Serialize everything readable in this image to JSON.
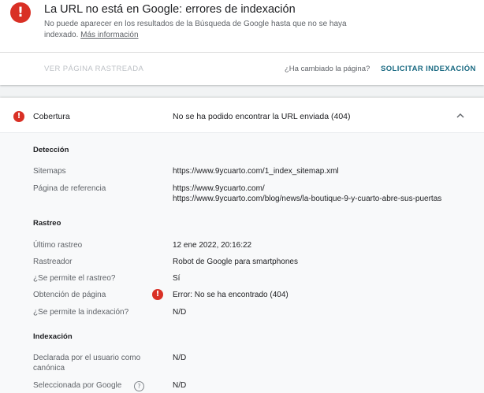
{
  "status_card": {
    "title": "La URL no está en Google: errores de indexación",
    "description": "No puede aparecer en los resultados de la Búsqueda de Google hasta que no se haya indexado.",
    "more_info_link": "Más información",
    "view_crawled_button": "VER PÁGINA RASTREADA",
    "changed_question": "¿Ha cambiado la página?",
    "request_indexing_button": "SOLICITAR INDEXACIÓN",
    "error_icon": "error-icon",
    "error_color": "#d93025"
  },
  "coverage": {
    "label": "Cobertura",
    "value": "No se ha podido encontrar la URL enviada (404)",
    "chevron_icon": "chevron-up-icon"
  },
  "detection": {
    "heading": "Detección",
    "sitemap_label": "Sitemaps",
    "sitemap_value": "https://www.9ycuarto.com/1_index_sitemap.xml",
    "referrer_label": "Página de referencia",
    "referrer_values": [
      "https://www.9ycuarto.com/",
      "https://www.9ycuarto.com/blog/news/la-boutique-9-y-cuarto-abre-sus-puertas"
    ]
  },
  "crawl": {
    "heading": "Rastreo",
    "rows": [
      {
        "label": "Último rastreo",
        "value": "12 ene 2022, 20:16:22"
      },
      {
        "label": "Rastreador",
        "value": "Robot de Google para smartphones"
      },
      {
        "label": "¿Se permite el rastreo?",
        "value": "Sí"
      },
      {
        "label": "Obtención de página",
        "value": "Error: No se ha encontrado (404)"
      },
      {
        "label": "¿Se permite la indexación?",
        "value": "N/D"
      }
    ]
  },
  "indexing": {
    "heading": "Indexación",
    "user_canonical_label": "Declarada por el usuario como canónica",
    "user_canonical_value": "N/D",
    "google_canonical_label": "Seleccionada por Google",
    "google_canonical_value": "N/D",
    "help_glyph": "?"
  }
}
